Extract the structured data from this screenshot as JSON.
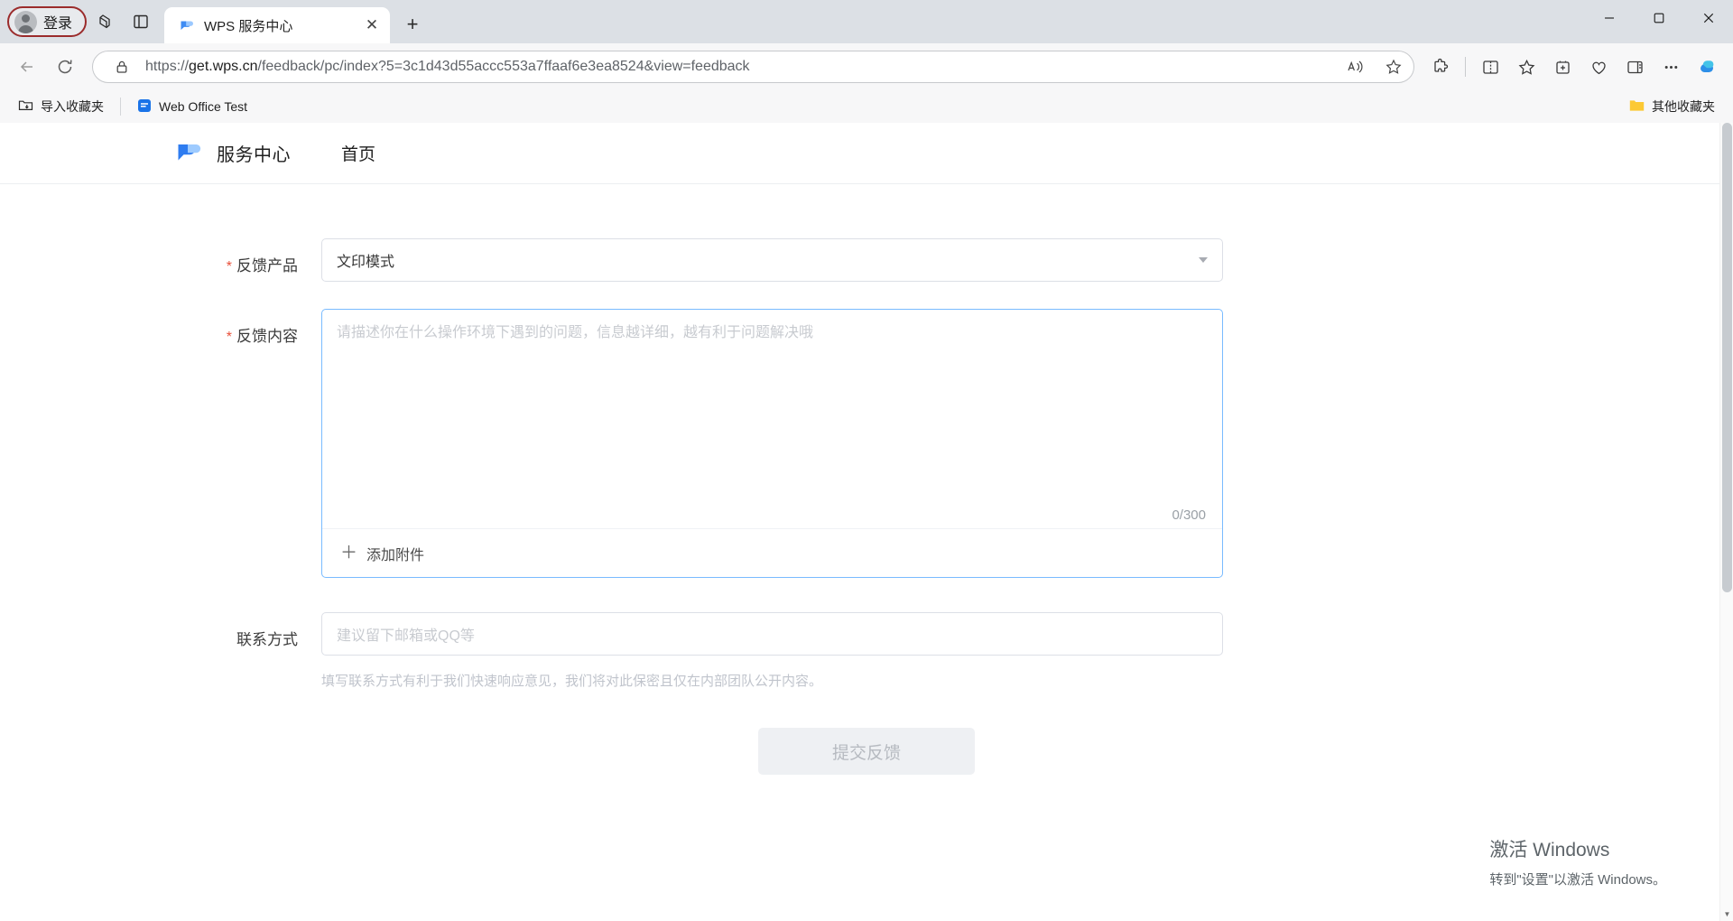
{
  "browser": {
    "profile_label": "登录",
    "tab": {
      "title": "WPS 服务中心",
      "close_label": "✕"
    },
    "new_tab_label": "+",
    "window": {
      "minimize": "—",
      "maximize": "▢",
      "close": "✕"
    },
    "omnibox": {
      "url_scheme": "https://",
      "url_host": "get.wps.cn",
      "url_path": "/feedback/pc/index?5=3c1d43d55accc553a7ffaaf6e3ea8524&view=feedback",
      "url_full": "https://get.wps.cn/feedback/pc/index?5=3c1d43d55accc553a7ffaaf6e3ea8524&view=feedback"
    },
    "bookmarks": {
      "import_label": "导入收藏夹",
      "item_label": "Web Office Test",
      "other_label": "其他收藏夹"
    }
  },
  "page": {
    "header": {
      "site_name": "服务中心",
      "nav_home": "首页"
    },
    "form": {
      "product": {
        "label": "反馈产品",
        "required": "*",
        "value": "文印模式"
      },
      "content": {
        "label": "反馈内容",
        "required": "*",
        "placeholder": "请描述你在什么操作环境下遇到的问题，信息越详细，越有利于问题解决哦",
        "counter": "0/300",
        "attach_label": "添加附件",
        "attach_plus": "＋"
      },
      "contact": {
        "label": "联系方式",
        "placeholder": "建议留下邮箱或QQ等",
        "hint": "填写联系方式有利于我们快速响应意见，我们将对此保密且仅在内部团队公开内容。"
      },
      "submit_label": "提交反馈"
    }
  },
  "watermark": {
    "title": "激活 Windows",
    "subtitle": "转到\"设置\"以激活 Windows。"
  },
  "colors": {
    "accent": "#4a8ef0",
    "required_star": "#e8503a",
    "focus_border": "#79bbff",
    "profile_outline": "#9b2c2c"
  }
}
